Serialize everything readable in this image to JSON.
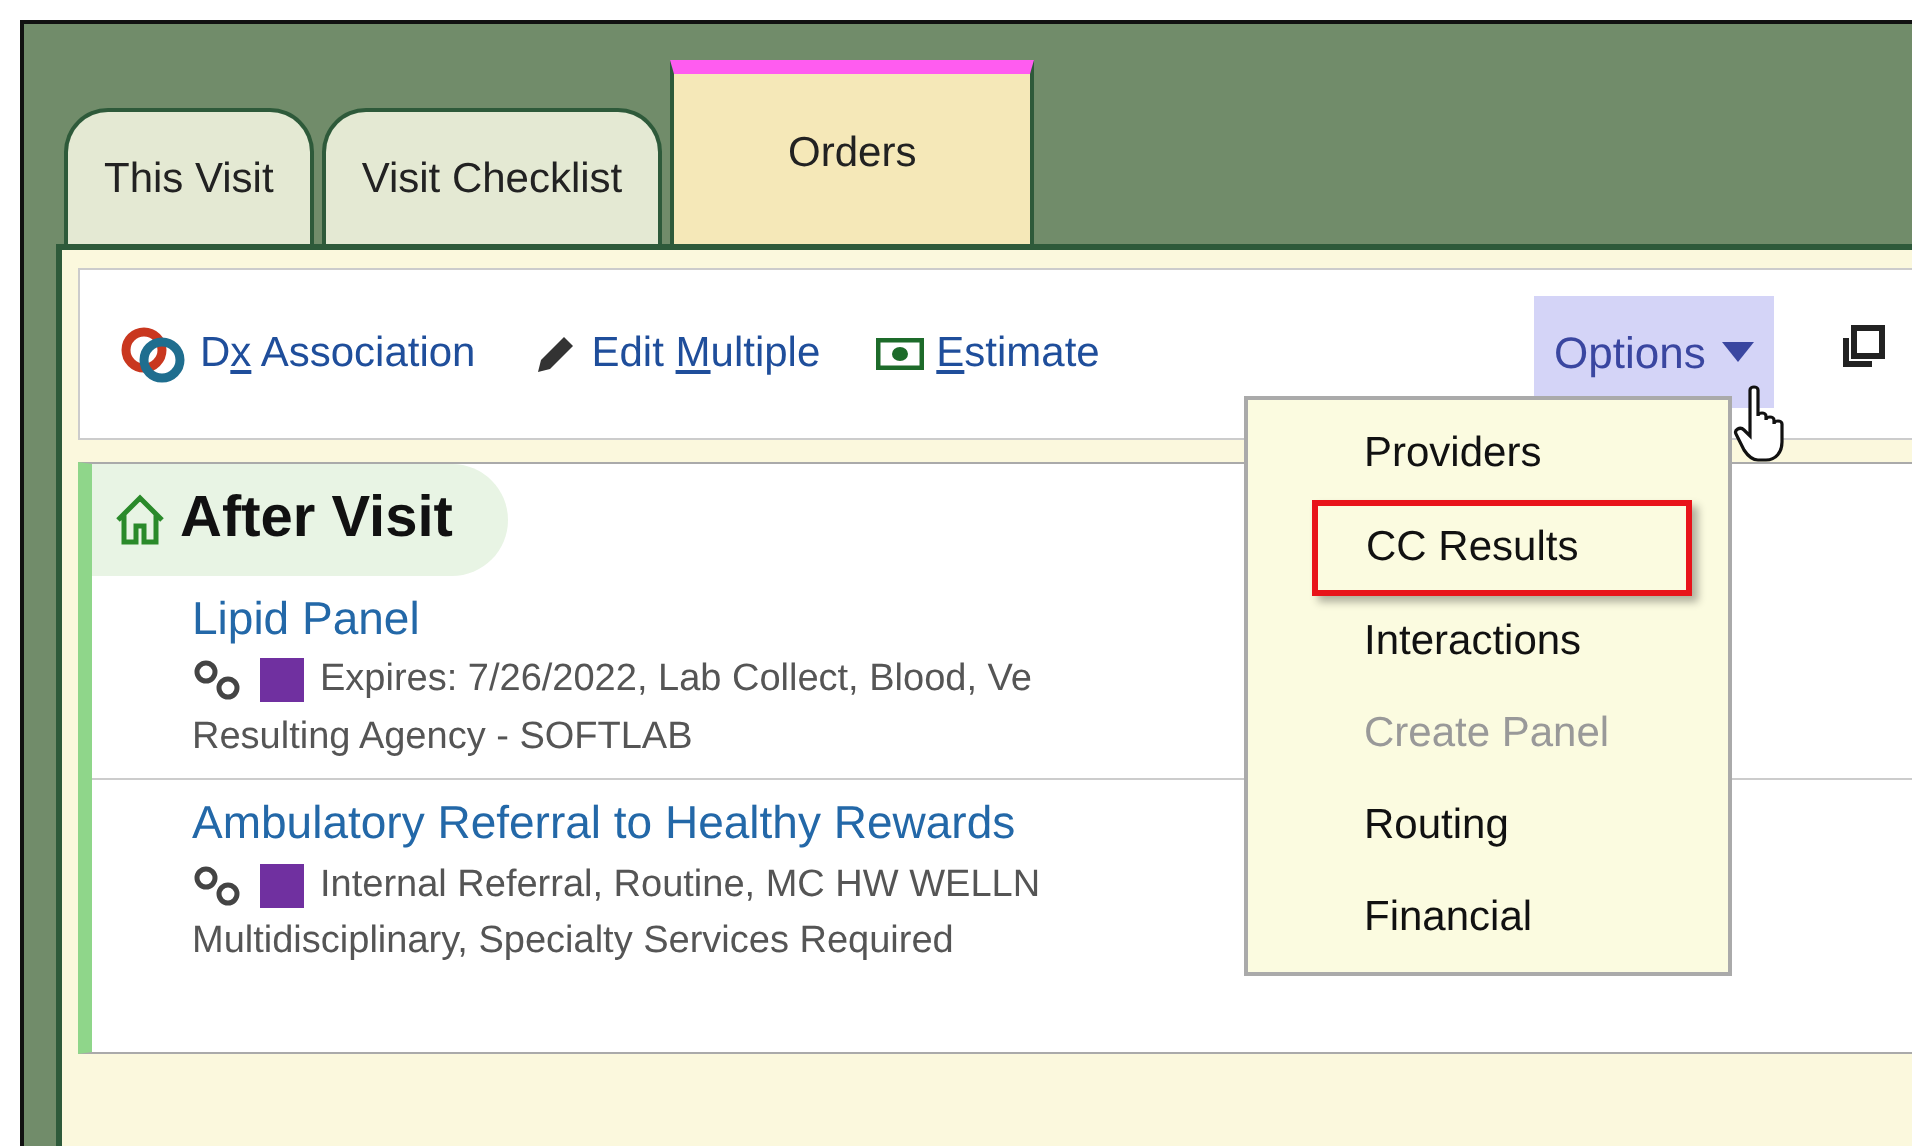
{
  "tabs": [
    {
      "label": "This Visit",
      "selected": false
    },
    {
      "label": "Visit Checklist",
      "selected": false
    },
    {
      "label": "Orders",
      "selected": true
    }
  ],
  "toolbar": {
    "actions": [
      {
        "kind": "dx",
        "before": "D",
        "key": "x",
        "after": " Association"
      },
      {
        "kind": "edit",
        "before": "Edit ",
        "key": "M",
        "after": "ultiple"
      },
      {
        "kind": "estimate",
        "key": "E",
        "after": "stimate"
      }
    ],
    "options": {
      "label": "Options",
      "expanded": true
    }
  },
  "options_menu": [
    {
      "label": "Providers",
      "highlighted": false,
      "disabled": false
    },
    {
      "label": "CC Results",
      "highlighted": true,
      "disabled": false
    },
    {
      "label": "Interactions",
      "highlighted": false,
      "disabled": false
    },
    {
      "label": "Create Panel",
      "highlighted": false,
      "disabled": true
    },
    {
      "label": "Routing",
      "highlighted": false,
      "disabled": false
    },
    {
      "label": "Financial",
      "highlighted": false,
      "disabled": false
    }
  ],
  "section": {
    "title": "After Visit",
    "orders": [
      {
        "name": "Lipid Panel",
        "color": "#7030a0",
        "details": "Expires: 7/26/2022, Lab Collect, Blood, Ve",
        "details_2": "Resulting Agency - SOFTLAB"
      },
      {
        "name": "Ambulatory Referral to Healthy Rewards",
        "color": "#7030a0",
        "details": "Internal Referral, Routine, MC HW WELLN",
        "details_2": "Multidisciplinary, Specialty Services Required"
      }
    ]
  }
}
